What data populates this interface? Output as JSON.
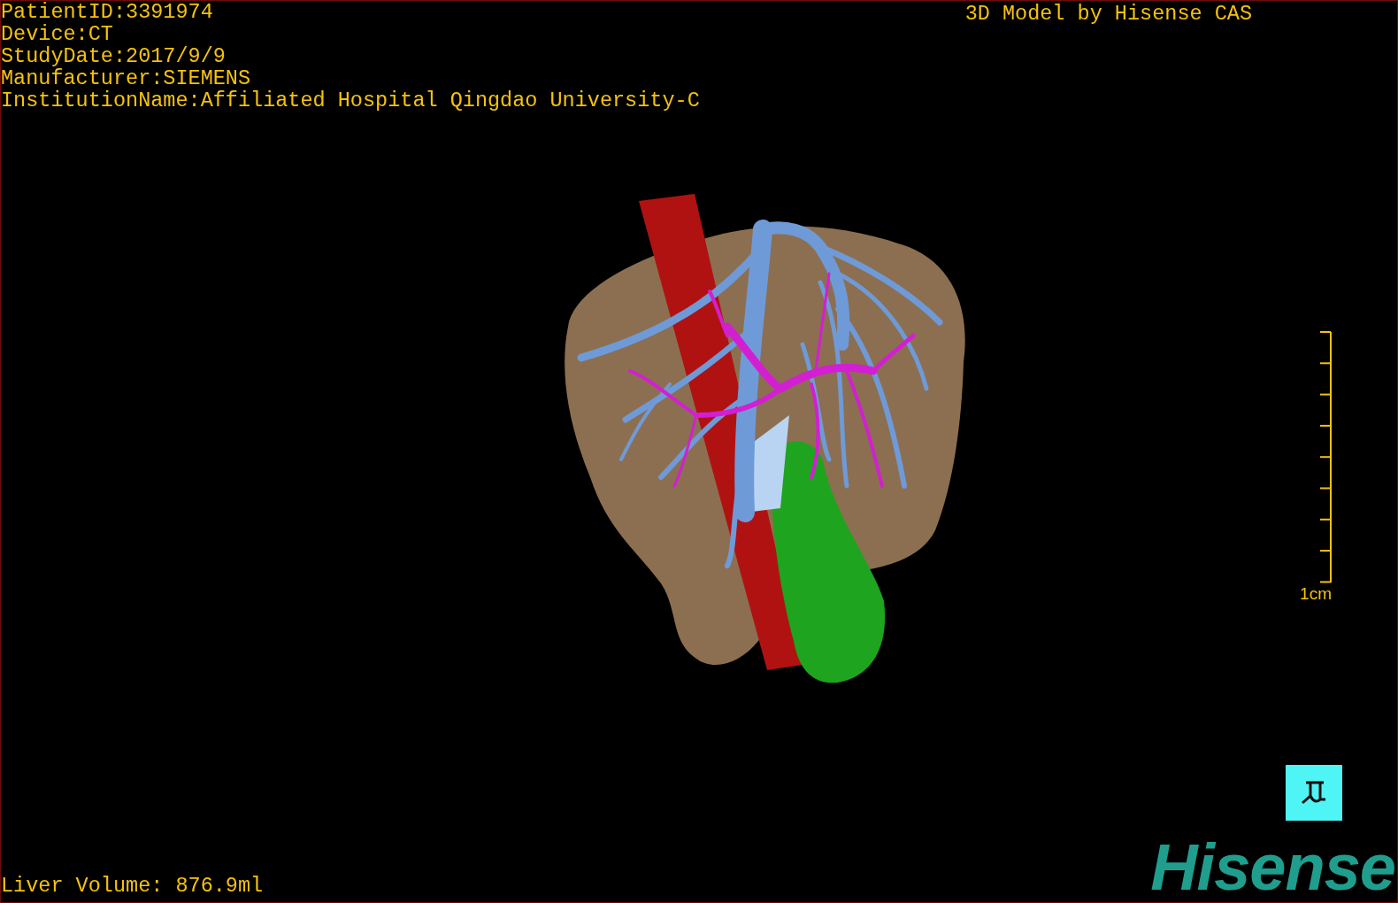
{
  "patient_info": [
    "PatientID:3391974",
    "Device:CT",
    "StudyDate:2017/9/9",
    "Manufacturer:SIEMENS",
    "InstitutionName:Affiliated Hospital Qingdao University-C"
  ],
  "title": "3D Model by Hisense CAS",
  "scale_bar": {
    "label": "1cm"
  },
  "liver_volume": "Liver Volume: 876.9ml",
  "logo": "Hisense"
}
